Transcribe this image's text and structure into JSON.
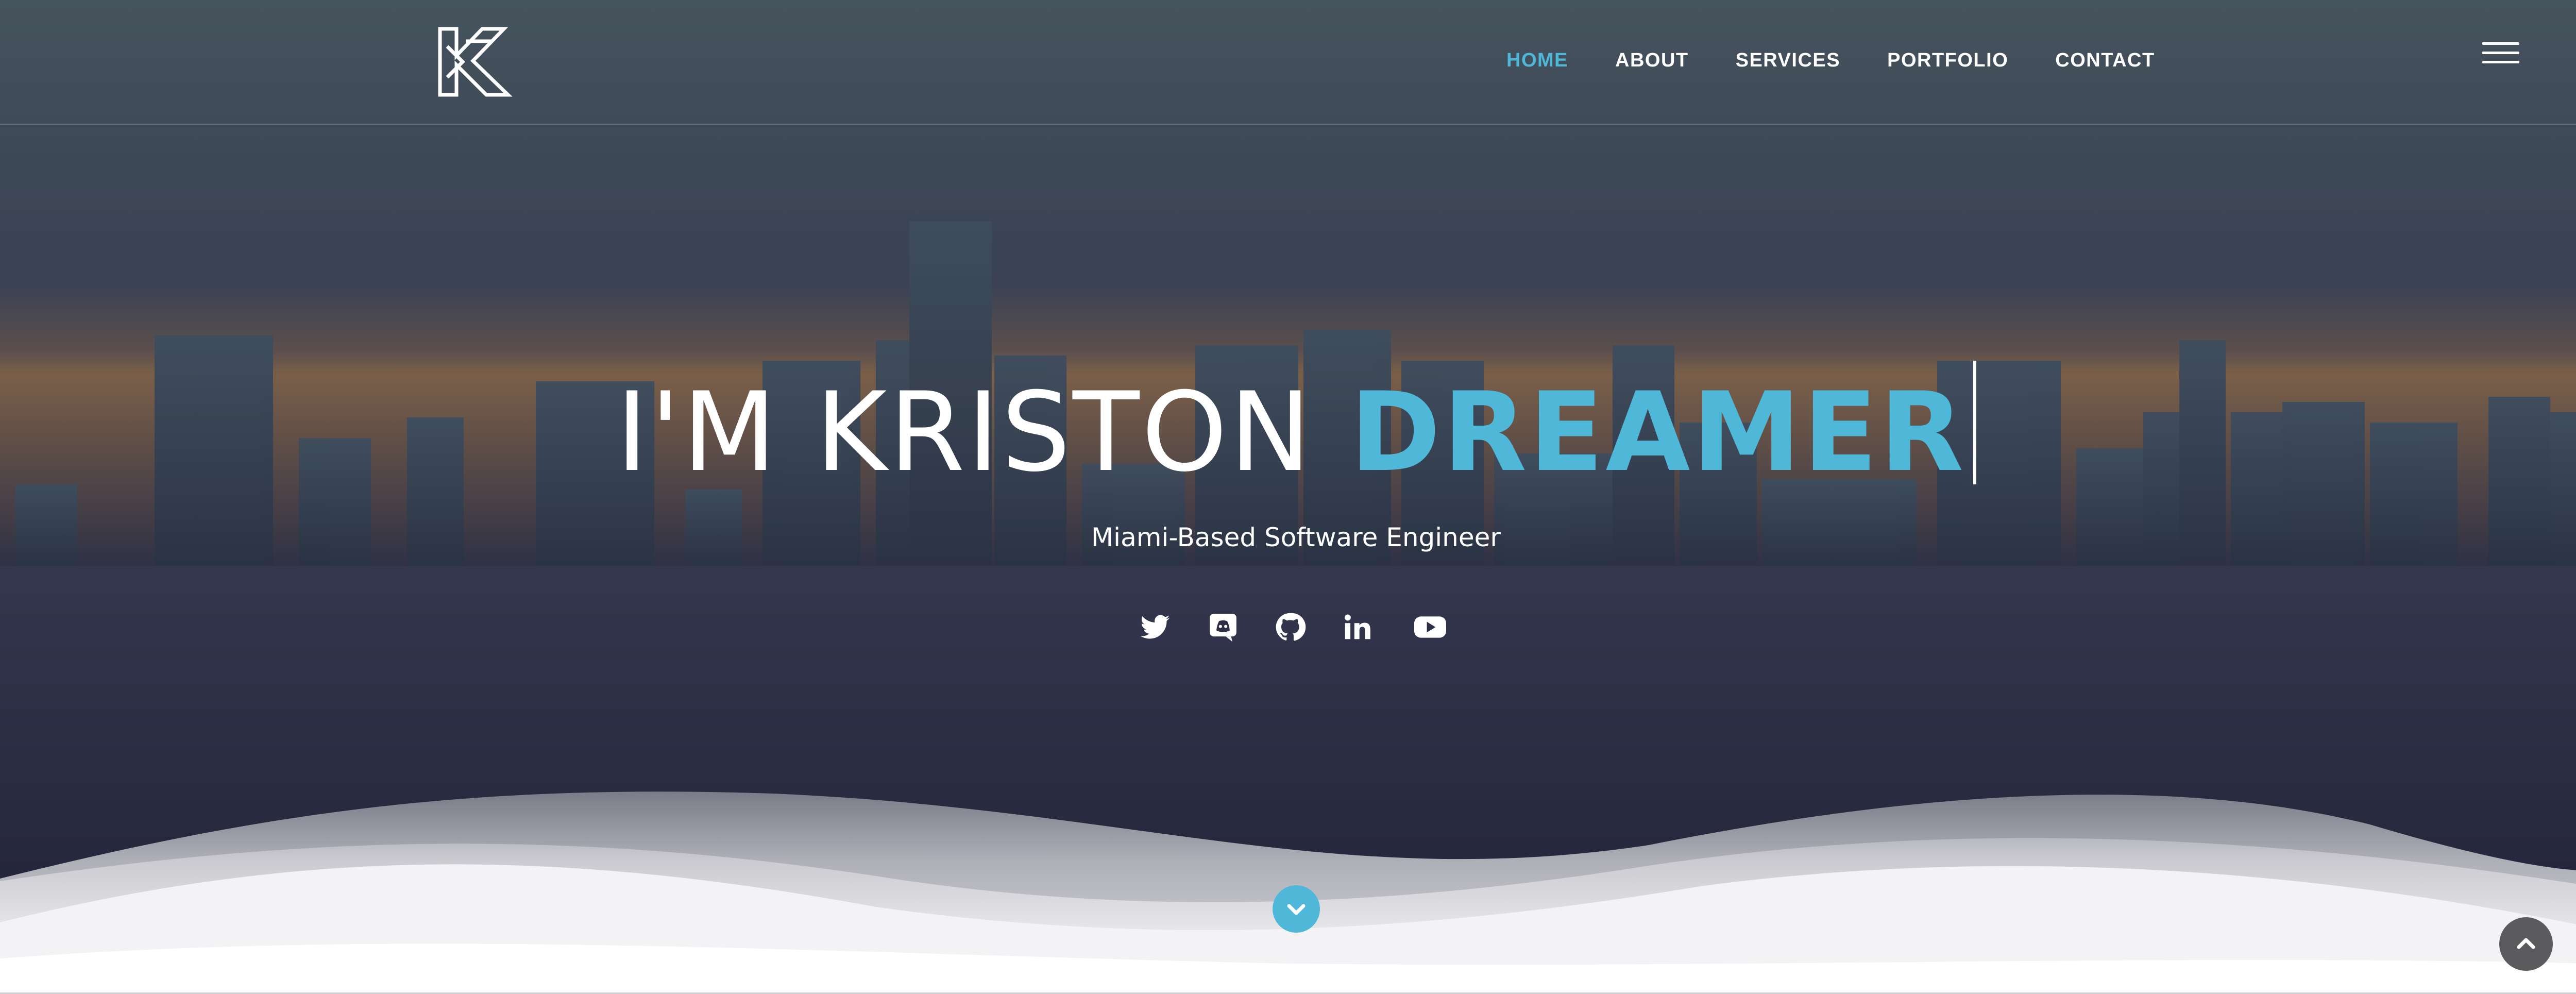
{
  "header": {
    "logo_icon": "k-monogram-logo",
    "nav": [
      {
        "label": "HOME",
        "active": true
      },
      {
        "label": "ABOUT",
        "active": false
      },
      {
        "label": "SERVICES",
        "active": false
      },
      {
        "label": "PORTFOLIO",
        "active": false
      },
      {
        "label": "CONTACT",
        "active": false
      }
    ],
    "menu_icon": "hamburger-menu-icon"
  },
  "hero": {
    "title_prefix": "I'M KRISTON",
    "title_accent": "DREAMER",
    "subtitle": "Miami-Based Software Engineer",
    "background": "city-skyline-photo",
    "socials": [
      {
        "icon": "twitter-icon"
      },
      {
        "icon": "discord-icon"
      },
      {
        "icon": "github-icon"
      },
      {
        "icon": "linkedin-icon"
      },
      {
        "icon": "youtube-icon"
      }
    ],
    "scroll_down_icon": "chevron-down-icon"
  },
  "back_to_top_icon": "chevron-up-icon",
  "colors": {
    "accent": "#4fb7d8",
    "text": "#ffffff",
    "overlay_top": "#46545e",
    "overlay_bottom": "#212238"
  }
}
